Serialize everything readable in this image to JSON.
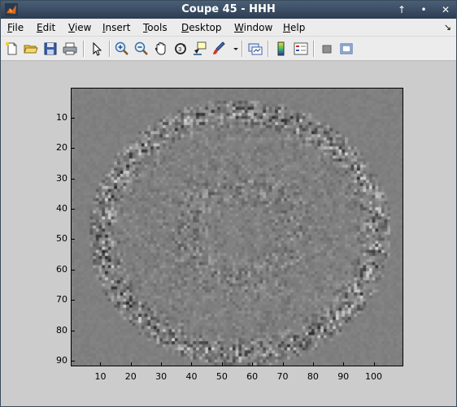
{
  "window": {
    "title": "Coupe 45 - HHH"
  },
  "title_controls": {
    "help": "↑",
    "minimize": "•",
    "close": "✕"
  },
  "menubar": {
    "items": [
      {
        "label": "File",
        "mnemonic": "F"
      },
      {
        "label": "Edit",
        "mnemonic": "E"
      },
      {
        "label": "View",
        "mnemonic": "V"
      },
      {
        "label": "Insert",
        "mnemonic": "I"
      },
      {
        "label": "Tools",
        "mnemonic": "T"
      },
      {
        "label": "Desktop",
        "mnemonic": "D"
      },
      {
        "label": "Window",
        "mnemonic": "W"
      },
      {
        "label": "Help",
        "mnemonic": "H"
      }
    ],
    "corner": "↘"
  },
  "toolbar": {
    "buttons": [
      {
        "icon": "new-figure-icon"
      },
      {
        "icon": "open-file-icon"
      },
      {
        "icon": "save-icon"
      },
      {
        "icon": "print-icon"
      },
      {
        "icon": "select-arrow-icon"
      },
      {
        "icon": "zoom-in-icon"
      },
      {
        "icon": "zoom-out-icon"
      },
      {
        "icon": "pan-hand-icon"
      },
      {
        "icon": "rotate-3d-icon"
      },
      {
        "icon": "data-cursor-icon"
      },
      {
        "icon": "brush-icon"
      },
      {
        "icon": "link-plot-icon"
      },
      {
        "icon": "colorbar-icon"
      },
      {
        "icon": "legend-icon"
      },
      {
        "icon": "hide-plot-tools-icon"
      },
      {
        "icon": "show-plot-tools-icon"
      }
    ]
  },
  "chart_data": {
    "type": "heatmap",
    "colormap": "gray",
    "title": "",
    "xlabel": "",
    "ylabel": "",
    "xlim": [
      0.5,
      109.5
    ],
    "ylim": [
      0.5,
      91.5
    ],
    "y_reversed": true,
    "x_ticks": [
      "10",
      "20",
      "30",
      "40",
      "50",
      "60",
      "70",
      "80",
      "90",
      "100"
    ],
    "y_ticks": [
      "10",
      "20",
      "30",
      "40",
      "50",
      "60",
      "70",
      "80",
      "90"
    ],
    "background_value": "mid-gray",
    "description_of_content": "high-frequency residual noise within an elliptical region"
  }
}
